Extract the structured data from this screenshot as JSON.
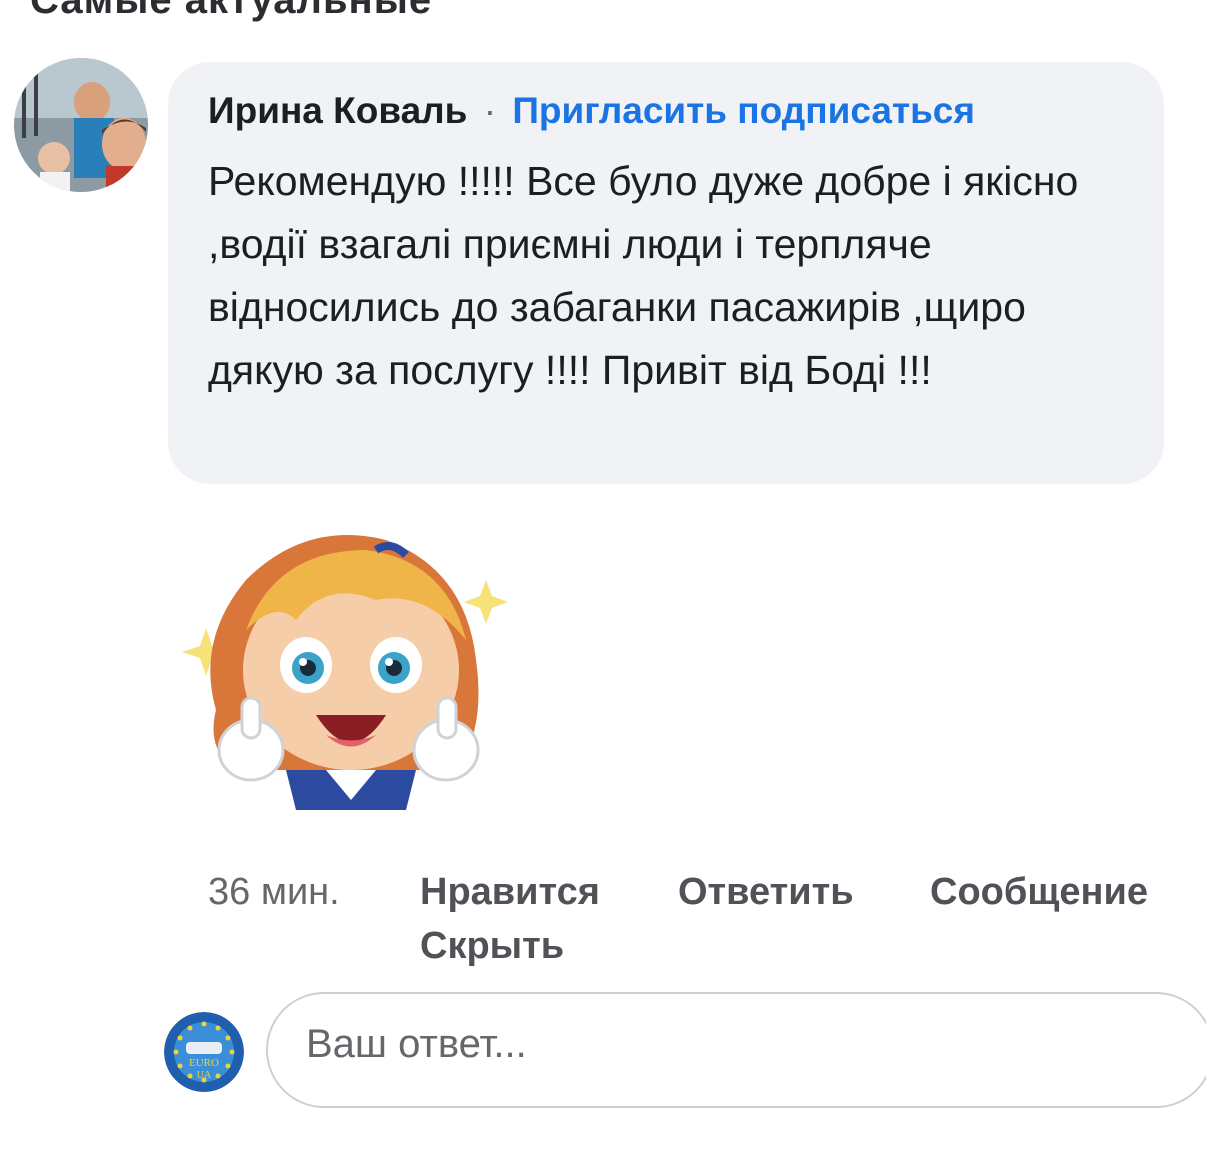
{
  "header_partial": "Самые актуальные",
  "comment": {
    "author": "Ирина Коваль",
    "separator": "·",
    "invite_link": "Пригласить подписаться",
    "text": "Рекомендую !!!!! Все було дуже добре і якісно ,водії взагалі приємні люди і терпляче відносились до забаганки пасажирів ,щиро дякую за послугу !!!! Привіт від Боді !!!",
    "avatar_icon": "profile-photo",
    "sticker_icon": "girl-thumbs-up-sticker"
  },
  "actions": {
    "time": "36 мин.",
    "like": "Нравится",
    "reply": "Ответить",
    "message": "Сообщение",
    "hide": "Скрыть"
  },
  "reply_box": {
    "placeholder": "Ваш ответ...",
    "avatar_text_top": "EURO",
    "avatar_text_bottom": "UA"
  },
  "colors": {
    "bubble": "#f0f2f5",
    "link": "#1b74e4",
    "muted": "#65676b",
    "action": "#505257"
  }
}
